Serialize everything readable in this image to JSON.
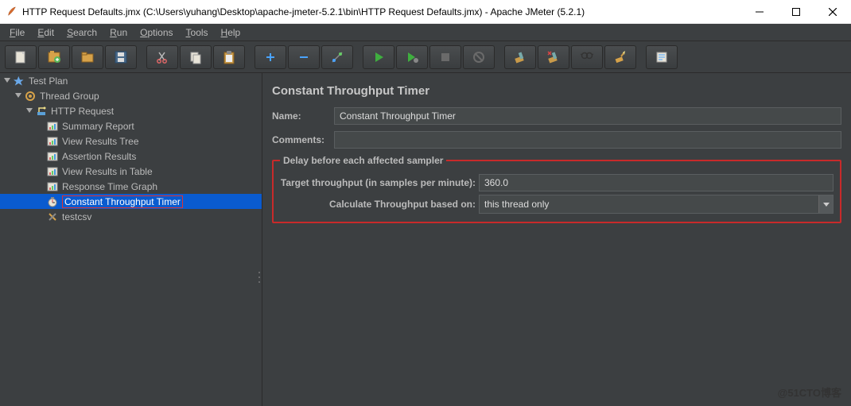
{
  "window": {
    "title": "HTTP Request Defaults.jmx (C:\\Users\\yuhang\\Desktop\\apache-jmeter-5.2.1\\bin\\HTTP Request Defaults.jmx) - Apache JMeter (5.2.1)"
  },
  "menu": {
    "file": "File",
    "edit": "Edit",
    "search": "Search",
    "run": "Run",
    "options": "Options",
    "tools": "Tools",
    "help": "Help"
  },
  "tree": {
    "test_plan": "Test Plan",
    "thread_group": "Thread Group",
    "http_request": "HTTP Request",
    "summary_report": "Summary Report",
    "view_results_tree": "View Results Tree",
    "assertion_results": "Assertion Results",
    "view_results_table": "View Results in Table",
    "response_time_graph": "Response Time Graph",
    "constant_throughput_timer": "Constant Throughput Timer",
    "testcsv": "testcsv"
  },
  "panel": {
    "heading": "Constant Throughput Timer",
    "name_label": "Name:",
    "name_value": "Constant Throughput Timer",
    "comments_label": "Comments:",
    "comments_value": "",
    "group_legend": "Delay before each affected sampler",
    "target_label": "Target throughput (in samples per minute):",
    "target_value": "360.0",
    "calc_label": "Calculate Throughput based on:",
    "calc_value": "this thread only"
  },
  "watermark": "@51CTO博客"
}
